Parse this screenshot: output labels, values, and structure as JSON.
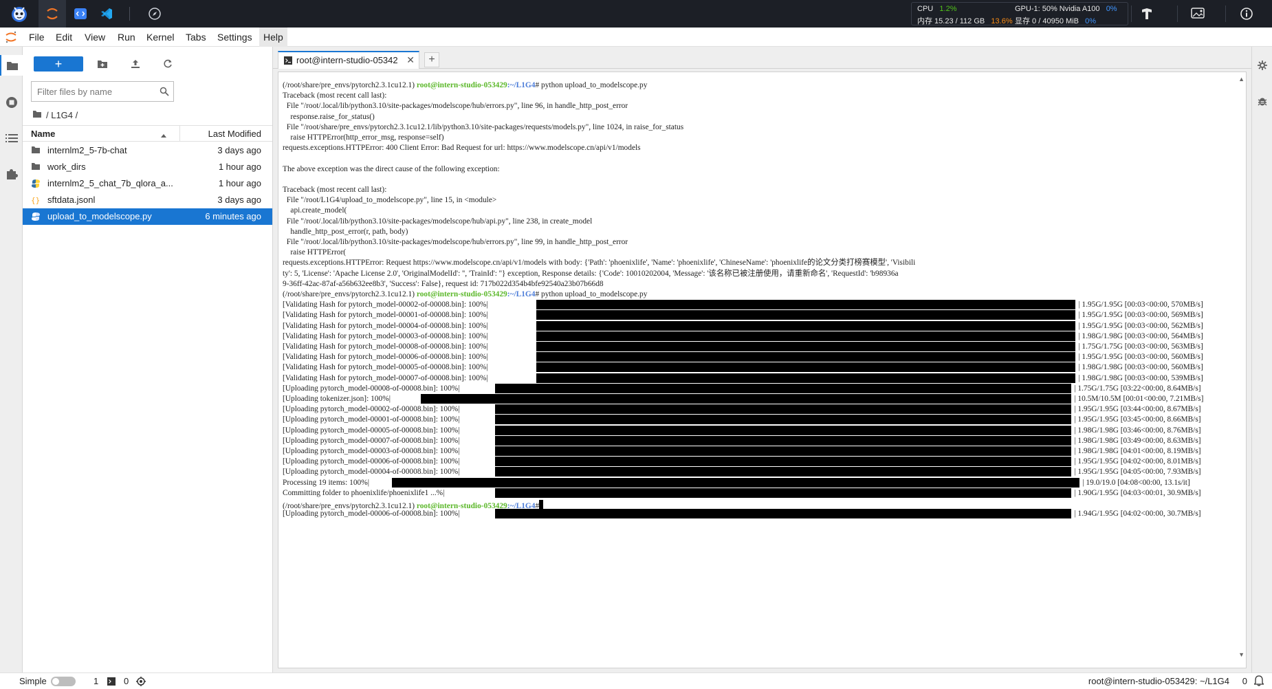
{
  "topbar": {
    "monitor": {
      "cpu_label": "CPU",
      "cpu_value": "1.2%",
      "mem_label": "内存 15.23 / 112 GB",
      "mem_value": "13.6%",
      "gpu_label": "GPU-1: 50% Nvidia A100",
      "gpu_value": "0%",
      "vram_label": "显存 0 / 40950 MiB",
      "vram_value": "0%"
    }
  },
  "menu": {
    "items": [
      "File",
      "Edit",
      "View",
      "Run",
      "Kernel",
      "Tabs",
      "Settings",
      "Help"
    ]
  },
  "filebrowser": {
    "new_label": "+",
    "search_placeholder": "Filter files by name",
    "breadcrumb": "/ L1G4 /",
    "col_name": "Name",
    "col_modified": "Last Modified",
    "files": [
      {
        "name": "internlm2_5-7b-chat",
        "modified": "3 days ago",
        "type": "folder"
      },
      {
        "name": "work_dirs",
        "modified": "1 hour ago",
        "type": "folder"
      },
      {
        "name": "internlm2_5_chat_7b_qlora_a...",
        "modified": "1 hour ago",
        "type": "python"
      },
      {
        "name": "sftdata.jsonl",
        "modified": "3 days ago",
        "type": "json"
      },
      {
        "name": "upload_to_modelscope.py",
        "modified": "6 minutes ago",
        "type": "python",
        "selected": true
      }
    ]
  },
  "tab": {
    "label": "root@intern-studio-05342",
    "close": "✕",
    "add": "+"
  },
  "terminal": {
    "prompt_env": "(/root/share/pre_envs/pytorch2.3.1cu12.1) ",
    "prompt_host": "root@intern-studio-053429",
    "prompt_path": ":~/L1G4",
    "lines": [
      {
        "kind": "prompt",
        "cmd": "# python upload_to_modelscope.py"
      },
      {
        "kind": "text",
        "text": "Traceback (most recent call last):"
      },
      {
        "kind": "text",
        "text": "  File \"/root/.local/lib/python3.10/site-packages/modelscope/hub/errors.py\", line 96, in handle_http_post_error"
      },
      {
        "kind": "text",
        "text": "    response.raise_for_status()"
      },
      {
        "kind": "text",
        "text": "  File \"/root/share/pre_envs/pytorch2.3.1cu12.1/lib/python3.10/site-packages/requests/models.py\", line 1024, in raise_for_status"
      },
      {
        "kind": "text",
        "text": "    raise HTTPError(http_error_msg, response=self)"
      },
      {
        "kind": "text",
        "text": "requests.exceptions.HTTPError: 400 Client Error: Bad Request for url: https://www.modelscope.cn/api/v1/models"
      },
      {
        "kind": "text",
        "text": ""
      },
      {
        "kind": "text",
        "text": "The above exception was the direct cause of the following exception:"
      },
      {
        "kind": "text",
        "text": ""
      },
      {
        "kind": "text",
        "text": "Traceback (most recent call last):"
      },
      {
        "kind": "text",
        "text": "  File \"/root/L1G4/upload_to_modelscope.py\", line 15, in <module>"
      },
      {
        "kind": "text",
        "text": "    api.create_model("
      },
      {
        "kind": "text",
        "text": "  File \"/root/.local/lib/python3.10/site-packages/modelscope/hub/api.py\", line 238, in create_model"
      },
      {
        "kind": "text",
        "text": "    handle_http_post_error(r, path, body)"
      },
      {
        "kind": "text",
        "text": "  File \"/root/.local/lib/python3.10/site-packages/modelscope/hub/errors.py\", line 99, in handle_http_post_error"
      },
      {
        "kind": "text",
        "text": "    raise HTTPError("
      },
      {
        "kind": "text",
        "text": "requests.exceptions.HTTPError: Request https://www.modelscope.cn/api/v1/models with body: {'Path': 'phoenixlife', 'Name': 'phoenixlife', 'ChineseName': 'phoenixlife的论文分类打榜赛模型', 'Visibili"
      },
      {
        "kind": "text",
        "text": "ty': 5, 'License': 'Apache License 2.0', 'OriginalModelId': '', 'TrainId': ''} exception, Response details: {'Code': 10010202004, 'Message': '该名称已被注册使用，请重新命名', 'RequestId': 'b98936a"
      },
      {
        "kind": "text",
        "text": "9-36ff-42ac-87af-a56b632ee8b3', 'Success': False}, request id: 717b022d354b4bfe92540a23b07b66d8"
      },
      {
        "kind": "prompt",
        "cmd": "# python upload_to_modelscope.py"
      },
      {
        "kind": "progress",
        "text": "[Validating Hash for pytorch_model-00002-of-00008.bin]: 100%|",
        "suffix": "| 1.95G/1.95G [00:03<00:00, 570MB/s]"
      },
      {
        "kind": "progress",
        "text": "[Validating Hash for pytorch_model-00001-of-00008.bin]: 100%|",
        "suffix": "| 1.95G/1.95G [00:03<00:00, 569MB/s]"
      },
      {
        "kind": "progress",
        "text": "[Validating Hash for pytorch_model-00004-of-00008.bin]: 100%|",
        "suffix": "| 1.95G/1.95G [00:03<00:00, 562MB/s]"
      },
      {
        "kind": "progress",
        "text": "[Validating Hash for pytorch_model-00003-of-00008.bin]: 100%|",
        "suffix": "| 1.98G/1.98G [00:03<00:00, 564MB/s]"
      },
      {
        "kind": "progress",
        "text": "[Validating Hash for pytorch_model-00008-of-00008.bin]: 100%|",
        "suffix": "| 1.75G/1.75G [00:03<00:00, 563MB/s]"
      },
      {
        "kind": "progress",
        "text": "[Validating Hash for pytorch_model-00006-of-00008.bin]: 100%|",
        "suffix": "| 1.95G/1.95G [00:03<00:00, 560MB/s]"
      },
      {
        "kind": "progress",
        "text": "[Validating Hash for pytorch_model-00005-of-00008.bin]: 100%|",
        "suffix": "| 1.98G/1.98G [00:03<00:00, 560MB/s]"
      },
      {
        "kind": "progress",
        "text": "[Validating Hash for pytorch_model-00007-of-00008.bin]: 100%|",
        "suffix": "| 1.98G/1.98G [00:03<00:00, 539MB/s]"
      },
      {
        "kind": "progress",
        "text": "[Uploading pytorch_model-00008-of-00008.bin]: 100%|",
        "suffix": "| 1.75G/1.75G [03:22<00:00, 8.64MB/s]"
      },
      {
        "kind": "progress",
        "text": "[Uploading tokenizer.json]: 100%|",
        "suffix": "| 10.5M/10.5M [00:01<00:00, 7.21MB/s]"
      },
      {
        "kind": "progress",
        "text": "[Uploading pytorch_model-00002-of-00008.bin]: 100%|",
        "suffix": "| 1.95G/1.95G [03:44<00:00, 8.67MB/s]"
      },
      {
        "kind": "progress",
        "text": "[Uploading pytorch_model-00001-of-00008.bin]: 100%|",
        "suffix": "| 1.95G/1.95G [03:45<00:00, 8.66MB/s]"
      },
      {
        "kind": "progress",
        "text": "[Uploading pytorch_model-00005-of-00008.bin]: 100%|",
        "suffix": "| 1.98G/1.98G [03:46<00:00, 8.76MB/s]"
      },
      {
        "kind": "progress",
        "text": "[Uploading pytorch_model-00007-of-00008.bin]: 100%|",
        "suffix": "| 1.98G/1.98G [03:49<00:00, 8.63MB/s]"
      },
      {
        "kind": "progress",
        "text": "[Uploading pytorch_model-00003-of-00008.bin]: 100%|",
        "suffix": "| 1.98G/1.98G [04:01<00:00, 8.19MB/s]"
      },
      {
        "kind": "progress",
        "text": "[Uploading pytorch_model-00006-of-00008.bin]: 100%|",
        "suffix": "| 1.95G/1.95G [04:02<00:00, 8.01MB/s]"
      },
      {
        "kind": "progress",
        "text": "[Uploading pytorch_model-00004-of-00008.bin]: 100%|",
        "suffix": "| 1.95G/1.95G [04:05<00:00, 7.93MB/s]"
      },
      {
        "kind": "progress",
        "text": "Processing 19 items: 100%|",
        "suffix": "| 19.0/19.0 [04:08<00:00, 13.1s/it]"
      },
      {
        "kind": "progress",
        "text": "Committing folder to phoenixlife/phoenixlife1 ...%|",
        "suffix": "| 1.90G/1.95G [04:03<00:01, 30.9MB/s]"
      },
      {
        "kind": "prompt",
        "cmd": "#",
        "cursor": true
      },
      {
        "kind": "progress",
        "text": "[Uploading pytorch_model-00006-of-00008.bin]: 100%|",
        "suffix": "| 1.94G/1.95G [04:02<00:00, 30.7MB/s]"
      }
    ]
  },
  "statusbar": {
    "mode": "Simple",
    "terminals": "1",
    "kernels": "0",
    "right_text": "root@intern-studio-053429: ~/L1G4",
    "right_count": "0"
  }
}
